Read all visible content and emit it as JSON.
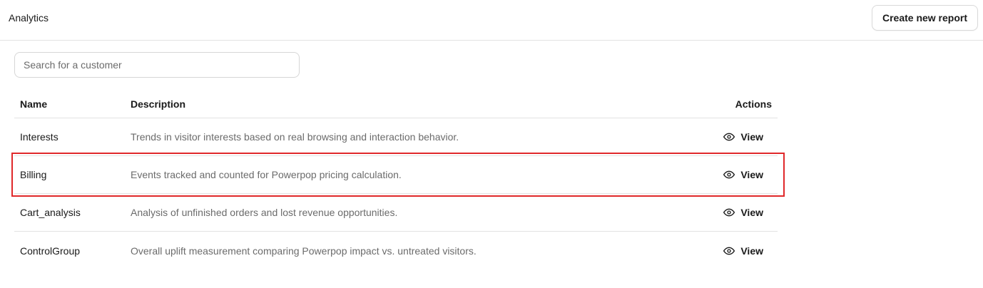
{
  "header": {
    "title": "Analytics",
    "create_button_label": "Create new report"
  },
  "search": {
    "placeholder": "Search for a customer",
    "value": ""
  },
  "table": {
    "columns": {
      "name": "Name",
      "description": "Description",
      "actions": "Actions"
    },
    "rows": [
      {
        "name": "Interests",
        "description": "Trends in visitor interests based on real browsing and interaction behavior.",
        "action_label": "View"
      },
      {
        "name": "Billing",
        "description": "Events tracked and counted for Powerpop pricing calculation.",
        "action_label": "View",
        "highlighted": true
      },
      {
        "name": "Cart_analysis",
        "description": "Analysis of unfinished orders and lost revenue opportunities.",
        "action_label": "View"
      },
      {
        "name": "ControlGroup",
        "description": "Overall uplift measurement comparing Powerpop impact vs. untreated visitors.",
        "action_label": "View"
      }
    ]
  },
  "icons": {
    "view": "eye-icon"
  },
  "colors": {
    "highlight": "#e0282a",
    "muted_text": "#6b6b6b",
    "border": "#e3e3e3"
  }
}
